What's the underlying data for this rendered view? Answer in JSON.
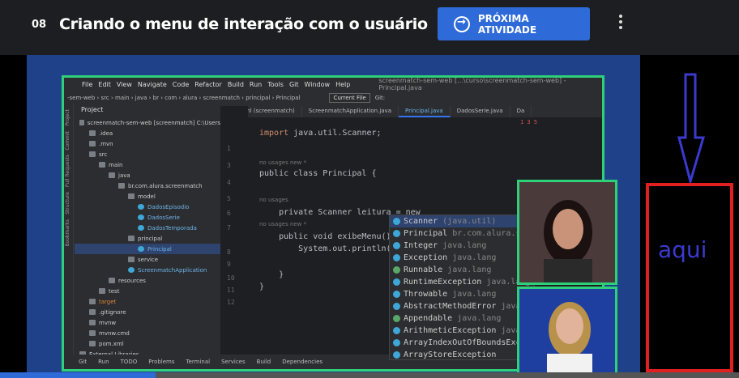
{
  "header": {
    "lesson_number": "08",
    "lesson_title": "Criando o menu de interação com o usuário",
    "next_button_label": "PRÓXIMA ATIVIDADE"
  },
  "ide": {
    "menu": [
      "File",
      "Edit",
      "View",
      "Navigate",
      "Code",
      "Refactor",
      "Build",
      "Run",
      "Tools",
      "Git",
      "Window",
      "Help"
    ],
    "window_title": "screenmatch-sem-web [...\\curso\\screenmatch-sem-web] - Principal.java",
    "breadcrumb": [
      "-sem-web",
      "src",
      "main",
      "java",
      "br",
      "com",
      "alura",
      "screenmatch",
      "principal",
      "Principal"
    ],
    "run_config": "Current File",
    "git_label": "Git:",
    "project_label": "Project",
    "tree": [
      {
        "label": "screenmatch-sem-web [screenmatch] C:\\Users",
        "indent": 0,
        "kind": "folder"
      },
      {
        "label": ".idea",
        "indent": 1,
        "kind": "folder"
      },
      {
        "label": ".mvn",
        "indent": 1,
        "kind": "folder"
      },
      {
        "label": "src",
        "indent": 1,
        "kind": "folder"
      },
      {
        "label": "main",
        "indent": 2,
        "kind": "folder"
      },
      {
        "label": "java",
        "indent": 3,
        "kind": "folder"
      },
      {
        "label": "br.com.alura.screenmatch",
        "indent": 4,
        "kind": "folder"
      },
      {
        "label": "model",
        "indent": 5,
        "kind": "folder"
      },
      {
        "label": "DadosEpisodio",
        "indent": 6,
        "kind": "cls"
      },
      {
        "label": "DadosSerie",
        "indent": 6,
        "kind": "cls"
      },
      {
        "label": "DadosTemporada",
        "indent": 6,
        "kind": "cls"
      },
      {
        "label": "principal",
        "indent": 5,
        "kind": "folder"
      },
      {
        "label": "Principal",
        "indent": 6,
        "kind": "cls",
        "selected": true
      },
      {
        "label": "service",
        "indent": 5,
        "kind": "folder"
      },
      {
        "label": "ScreenmatchApplication",
        "indent": 5,
        "kind": "cls"
      },
      {
        "label": "resources",
        "indent": 3,
        "kind": "folder"
      },
      {
        "label": "test",
        "indent": 2,
        "kind": "folder"
      },
      {
        "label": "target",
        "indent": 1,
        "kind": "target"
      },
      {
        "label": ".gitignore",
        "indent": 1,
        "kind": "file"
      },
      {
        "label": "mvnw",
        "indent": 1,
        "kind": "file"
      },
      {
        "label": "mvnw.cmd",
        "indent": 1,
        "kind": "file"
      },
      {
        "label": "pom.xml",
        "indent": 1,
        "kind": "file"
      },
      {
        "label": "External Libraries",
        "indent": 0,
        "kind": "folder"
      }
    ],
    "tabs": [
      {
        "label": "pom.xml (screenmatch)",
        "active": false
      },
      {
        "label": "ScreenmatchApplication.java",
        "active": false
      },
      {
        "label": "Principal.java",
        "active": true
      },
      {
        "label": "DadosSerie.java",
        "active": false
      },
      {
        "label": "Da",
        "active": false
      }
    ],
    "line_numbers": [
      "1",
      "3",
      "4",
      "5",
      "6",
      "7",
      "8",
      "9",
      "10",
      "11",
      "12"
    ],
    "code": {
      "l1": "import java.util.Scanner;",
      "hint1": "no usages    new *",
      "l5": "public class Principal {",
      "hint2": "no usages",
      "l7": "    private Scanner leitura = new",
      "hint3": "no usages    new *",
      "l8": "    public void exibeMenu()",
      "l9": "        System.out.println(",
      "l11": "    }",
      "l12": "}"
    },
    "completion": [
      {
        "name": "Scanner",
        "pkg": "(java.util)",
        "kind": "class"
      },
      {
        "name": "Principal",
        "pkg": "br.com.alura.s",
        "kind": "class"
      },
      {
        "name": "Integer",
        "pkg": "java.lang",
        "kind": "class"
      },
      {
        "name": "Exception",
        "pkg": "java.lang",
        "kind": "class"
      },
      {
        "name": "Runnable",
        "pkg": "java.lang",
        "kind": "iface"
      },
      {
        "name": "RuntimeException",
        "pkg": "java.lang",
        "kind": "class"
      },
      {
        "name": "Throwable",
        "pkg": "java.lang",
        "kind": "class"
      },
      {
        "name": "AbstractMethodError",
        "pkg": "java",
        "kind": "class"
      },
      {
        "name": "Appendable",
        "pkg": "java.lang",
        "kind": "iface"
      },
      {
        "name": "ArithmeticException",
        "pkg": "java",
        "kind": "class"
      },
      {
        "name": "ArrayIndexOutOfBoundsExc",
        "pkg": "",
        "kind": "class"
      },
      {
        "name": "ArrayStoreException",
        "pkg": "",
        "kind": "class"
      }
    ],
    "status_items": [
      "Git",
      "Run",
      "TODO",
      "Problems",
      "Terminal",
      "Services",
      "Build",
      "Dependencies"
    ],
    "inspection": "1  3  5"
  },
  "annotation": {
    "label": "aqui",
    "box_color": "#e02020",
    "arrow_color": "#3a3ad0"
  },
  "player": {
    "progress": 0.21
  }
}
